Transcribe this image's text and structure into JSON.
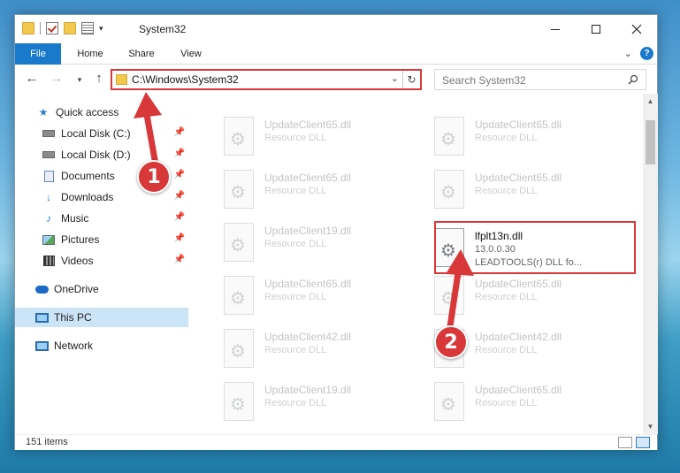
{
  "window": {
    "title": "System32",
    "qat_caret": "▾"
  },
  "ribbon": {
    "tabs": [
      {
        "label": "File"
      },
      {
        "label": "Home"
      },
      {
        "label": "Share"
      },
      {
        "label": "View"
      }
    ],
    "help": "?"
  },
  "navigation": {
    "address": "C:\\Windows\\System32",
    "search_placeholder": "Search System32"
  },
  "sidebar": {
    "items": [
      {
        "label": "Quick access",
        "icon": "star-icon"
      },
      {
        "label": "Local Disk (C:)",
        "icon": "drive-icon",
        "pinned": true
      },
      {
        "label": "Local Disk (D:)",
        "icon": "drive-icon",
        "pinned": true
      },
      {
        "label": "Documents",
        "icon": "documents-icon",
        "pinned": true
      },
      {
        "label": "Downloads",
        "icon": "downloads-icon",
        "pinned": true
      },
      {
        "label": "Music",
        "icon": "music-icon",
        "pinned": true
      },
      {
        "label": "Pictures",
        "icon": "pictures-icon",
        "pinned": true
      },
      {
        "label": "Videos",
        "icon": "videos-icon",
        "pinned": true
      },
      {
        "label": "OneDrive",
        "icon": "onedrive-icon"
      },
      {
        "label": "This PC",
        "icon": "computer-icon",
        "selected": true
      },
      {
        "label": "Network",
        "icon": "network-icon"
      }
    ]
  },
  "files": [
    {
      "name": "UpdateClient65.dll",
      "desc": "Resource DLL"
    },
    {
      "name": "UpdateClient65.dll",
      "desc": "Resource DLL"
    },
    {
      "name": "UpdateClient65.dll",
      "desc": "Resource DLL"
    },
    {
      "name": "UpdateClient65.dll",
      "desc": "Resource DLL"
    },
    {
      "name": "UpdateClient19.dll",
      "desc": "Resource DLL"
    },
    {
      "name": "lfplt13n.dll",
      "version": "13.0.0.30",
      "desc": "LEADTOOLS(r) DLL fo...",
      "highlighted": true
    },
    {
      "name": "UpdateClient65.dll",
      "desc": "Resource DLL"
    },
    {
      "name": "UpdateClient65.dll",
      "desc": "Resource DLL"
    },
    {
      "name": "UpdateClient42.dll",
      "desc": "Resource DLL"
    },
    {
      "name": "UpdateClient42.dll",
      "desc": "Resource DLL"
    },
    {
      "name": "UpdateClient19.dll",
      "desc": "Resource DLL"
    },
    {
      "name": "UpdateClient65.dll",
      "desc": "Resource DLL"
    }
  ],
  "status": {
    "count": "151 items"
  },
  "annotations": {
    "step1": "1",
    "step2": "2",
    "color": "#d8383a"
  }
}
